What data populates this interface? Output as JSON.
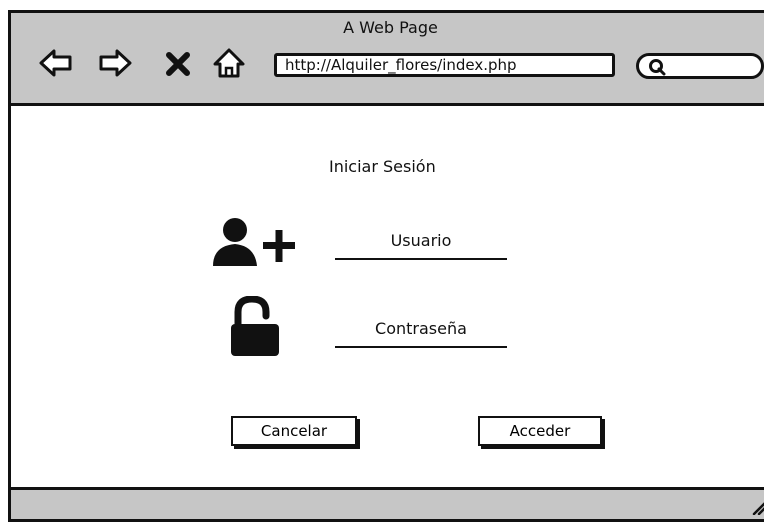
{
  "window": {
    "title": "A Web Page"
  },
  "toolbar": {
    "back_icon": "back-arrow-icon",
    "forward_icon": "forward-arrow-icon",
    "stop_icon": "close-icon",
    "home_icon": "home-icon",
    "url": "http://Alquiler_flores/index.php",
    "search_icon": "search-icon"
  },
  "login": {
    "heading": "Iniciar Sesión",
    "user_icon": "add-user-icon",
    "user_label": "Usuario",
    "lock_icon": "unlocked-padlock-icon",
    "password_label": "Contraseña",
    "cancel_label": "Cancelar",
    "submit_label": "Acceder"
  }
}
